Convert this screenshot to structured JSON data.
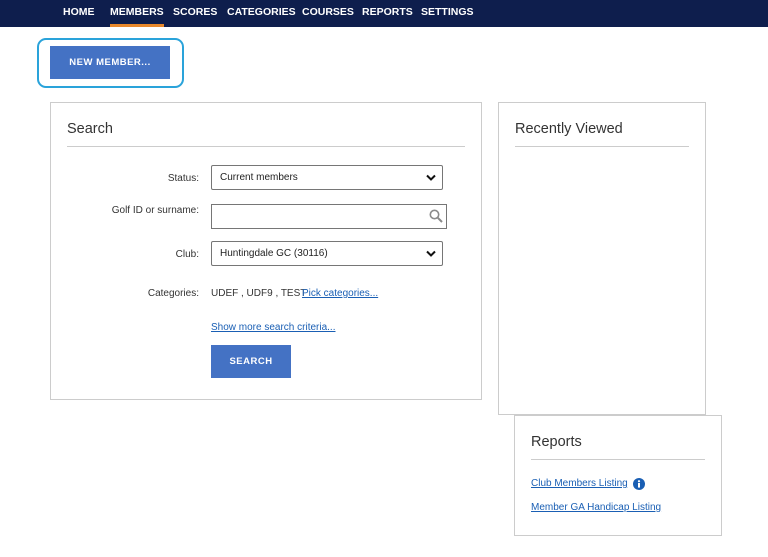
{
  "nav": {
    "items": [
      {
        "label": "HOME"
      },
      {
        "label": "MEMBERS"
      },
      {
        "label": "SCORES"
      },
      {
        "label": "CATEGORIES"
      },
      {
        "label": "COURSES"
      },
      {
        "label": "REPORTS"
      },
      {
        "label": "SETTINGS"
      }
    ],
    "active": "MEMBERS"
  },
  "actions": {
    "new_member_label": "NEW MEMBER..."
  },
  "search": {
    "title": "Search",
    "status_label": "Status:",
    "status_value": "Current members",
    "golf_id_label": "Golf ID or surname:",
    "golf_id_value": "",
    "club_label": "Club:",
    "club_value": "Huntingdale GC (30116)",
    "categories_label": "Categories:",
    "categories_value": "UDEF , UDF9 , TEST",
    "pick_categories_link": "Pick categories...",
    "more_criteria_link": "Show more search criteria...",
    "search_button_label": "SEARCH"
  },
  "recently_viewed": {
    "title": "Recently Viewed"
  },
  "reports": {
    "title": "Reports",
    "links": [
      {
        "label": "Club Members Listing"
      },
      {
        "label": "Member GA Handicap Listing"
      }
    ]
  },
  "colors": {
    "nav_bg": "#0e1e4d",
    "nav_active_underline": "#e8882b",
    "button_bg": "#4472c4",
    "highlight_outline": "#2aa3da",
    "link": "#1a5fb4"
  },
  "icons": {
    "search_field": "magnifier-icon",
    "select_arrow": "chevron-down-icon",
    "report_info": "info-icon"
  }
}
